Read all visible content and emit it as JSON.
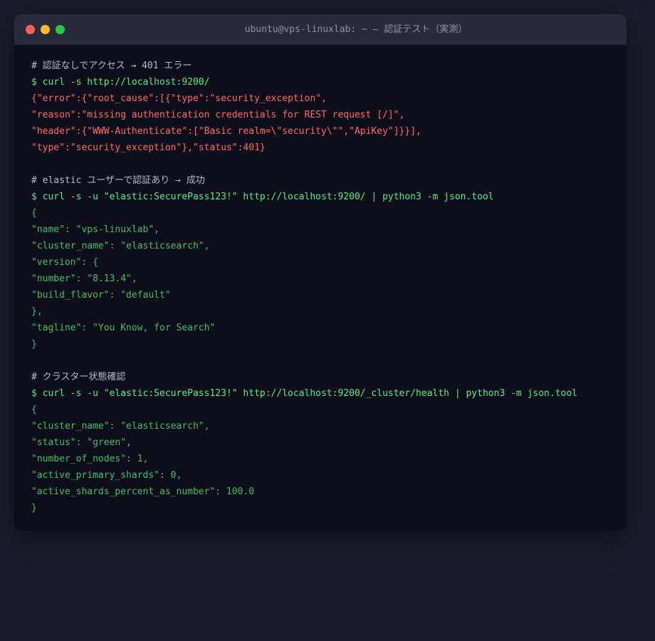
{
  "window": {
    "title": "ubuntu@vps-linuxlab: ~ — 認証テスト（実測）"
  },
  "colors": {
    "background": "#1b1b2b",
    "terminal_bg": "#0e0e1a",
    "titlebar_bg": "#2a2a3d",
    "comment": "#b8bac8",
    "command": "#4ff08a",
    "error": "#ff6a6a",
    "json_output": "#3fc06a",
    "close": "#ff5f57",
    "minimize": "#febc2e",
    "maximize": "#28c840"
  },
  "sections": [
    {
      "comment": "# 認証なしでアクセス → 401 エラー",
      "command": "$ curl -s http://localhost:9200/",
      "output_type": "error",
      "output": [
        "{\"error\":{\"root_cause\":[{\"type\":\"security_exception\",",
        "\"reason\":\"missing authentication credentials for REST request [/]\",",
        "\"header\":{\"WWW-Authenticate\":[\"Basic realm=\\\"security\\\"\",\"ApiKey\"]}}],",
        "\"type\":\"security_exception\"},\"status\":401}"
      ]
    },
    {
      "comment": "# elastic ユーザーで認証あり → 成功",
      "command": "$ curl -s -u \"elastic:SecurePass123!\" http://localhost:9200/ | python3 -m json.tool",
      "output_type": "json",
      "output": [
        "{",
        "\"name\": \"vps-linuxlab\",",
        "\"cluster_name\": \"elasticsearch\",",
        "\"version\": {",
        "\"number\": \"8.13.4\",",
        "\"build_flavor\": \"default\"",
        "},",
        "\"tagline\": \"You Know, for Search\"",
        "}"
      ]
    },
    {
      "comment": "# クラスター状態確認",
      "command": "$ curl -s -u \"elastic:SecurePass123!\" http://localhost:9200/_cluster/health | python3 -m json.tool",
      "output_type": "json",
      "output": [
        "{",
        "\"cluster_name\": \"elasticsearch\",",
        "\"status\": \"green\",",
        "\"number_of_nodes\": 1,",
        "\"active_primary_shards\": 0,",
        "\"active_shards_percent_as_number\": 100.0",
        "}"
      ]
    }
  ]
}
